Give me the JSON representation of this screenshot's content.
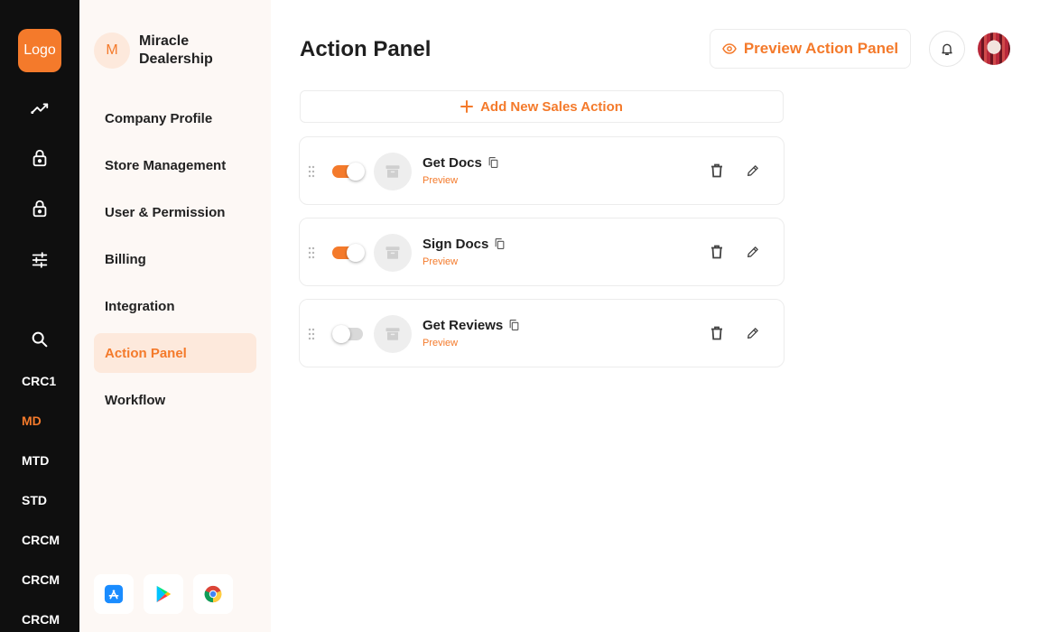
{
  "brand": {
    "logo_text": "Logo",
    "accent": "#f47a2b",
    "rail_bg": "#0f0f0f",
    "sidebar_bg": "#fdf8f5"
  },
  "rail": {
    "icons": [
      "analytics-icon",
      "lock-icon",
      "lock-icon",
      "sliders-icon",
      "search-icon"
    ],
    "items": [
      {
        "label": "CRC1",
        "active": false
      },
      {
        "label": "MD",
        "active": true
      },
      {
        "label": "MTD",
        "active": false
      },
      {
        "label": "STD",
        "active": false
      },
      {
        "label": "CRCM",
        "active": false
      },
      {
        "label": "CRCM",
        "active": false
      },
      {
        "label": "CRCM",
        "active": false
      }
    ]
  },
  "org": {
    "initial": "M",
    "name": "Miracle Dealership"
  },
  "sidebar": {
    "items": [
      {
        "label": "Company Profile",
        "active": false
      },
      {
        "label": "Store Management",
        "active": false
      },
      {
        "label": "User & Permission",
        "active": false
      },
      {
        "label": "Billing",
        "active": false
      },
      {
        "label": "Integration",
        "active": false
      },
      {
        "label": "Action Panel",
        "active": true
      },
      {
        "label": "Workflow",
        "active": false
      }
    ],
    "stores": [
      "app-store-icon",
      "google-play-icon",
      "chrome-icon"
    ]
  },
  "header": {
    "title": "Action Panel",
    "preview_button": "Preview Action Panel"
  },
  "add_action_label": "Add New Sales Action",
  "actions": [
    {
      "name": "Get Docs",
      "preview": "Preview",
      "enabled": true
    },
    {
      "name": "Sign Docs",
      "preview": "Preview",
      "enabled": true
    },
    {
      "name": "Get Reviews",
      "preview": "Preview",
      "enabled": false
    }
  ]
}
